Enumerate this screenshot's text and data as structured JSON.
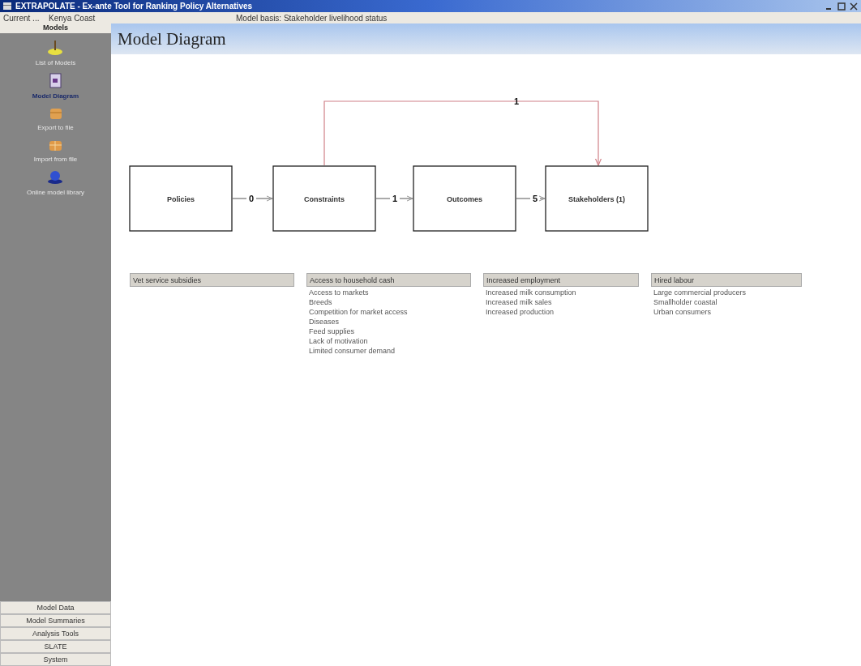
{
  "window": {
    "title": "EXTRAPOLATE - Ex-ante Tool for Ranking Policy Alternatives"
  },
  "info_bar": {
    "current_label": "Current ...",
    "current_value": "Kenya Coast",
    "model_basis": "Model basis: Stakeholder livelihood status"
  },
  "sidebar": {
    "title": "Models",
    "items": [
      {
        "label": "List of Models",
        "selected": false
      },
      {
        "label": "Model Diagram",
        "selected": true
      },
      {
        "label": "Export to file",
        "selected": false
      },
      {
        "label": "Import from file",
        "selected": false
      },
      {
        "label": "Online model library",
        "selected": false
      }
    ],
    "sections": [
      "Model Data",
      "Model Summaries",
      "Analysis Tools",
      "SLATE",
      "System"
    ]
  },
  "page": {
    "title": "Model Diagram"
  },
  "diagram": {
    "nodes": [
      "Policies",
      "Constraints",
      "Outcomes",
      "Stakeholders (1)"
    ],
    "links": [
      "0",
      "1",
      "5"
    ],
    "feedback_label": "1"
  },
  "lists": [
    {
      "header": "Vet service subsidies"
    },
    {
      "header": "Access to household cash",
      "items": [
        "Access to markets",
        "Breeds",
        "Competition for market access",
        "Diseases",
        "Feed supplies",
        "Lack of motivation",
        "Limited consumer demand"
      ]
    },
    {
      "header": "Increased employment",
      "items": [
        "Increased milk consumption",
        "Increased milk sales",
        "Increased production"
      ]
    },
    {
      "header": "Hired labour",
      "items": [
        "Large commercial producers",
        "Smallholder coastal",
        "Urban consumers"
      ]
    }
  ]
}
